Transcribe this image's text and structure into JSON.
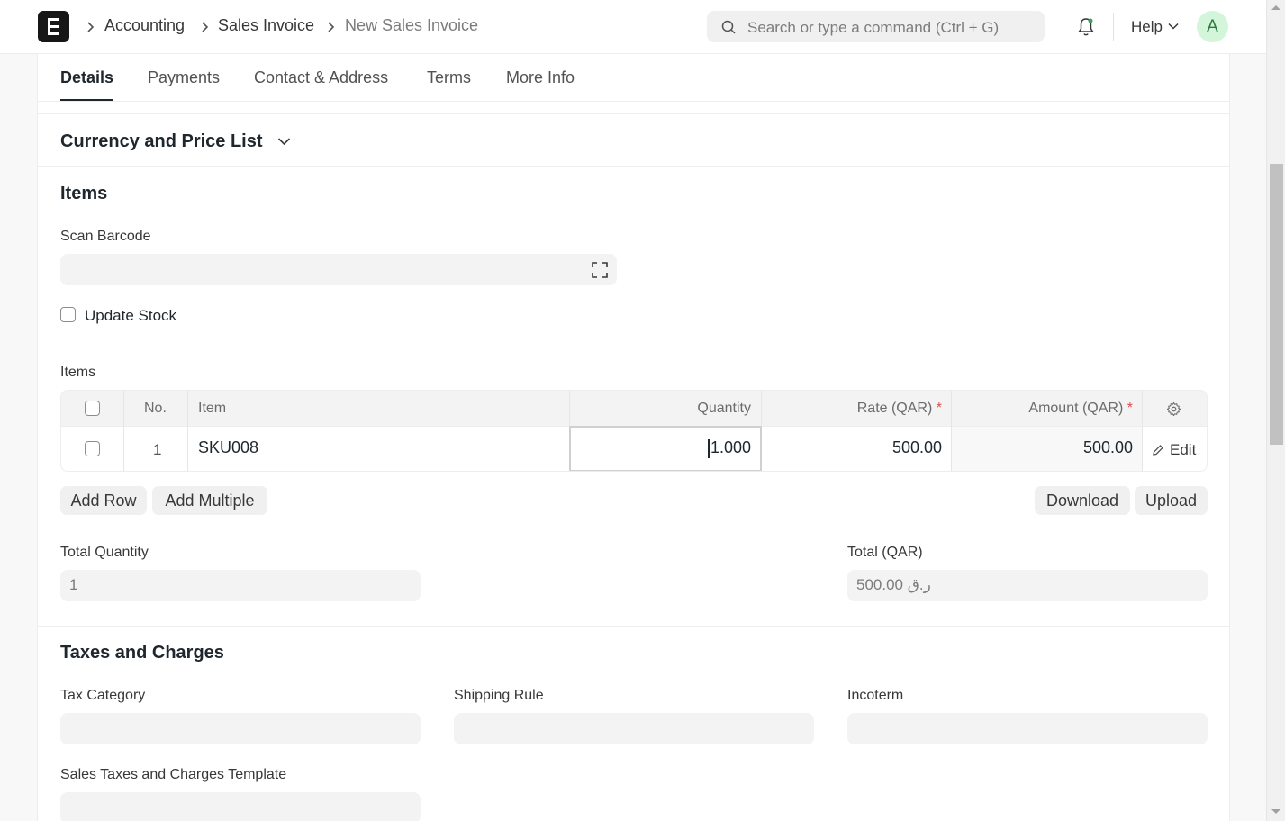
{
  "navbar": {
    "breadcrumbs": [
      "Accounting",
      "Sales Invoice",
      "New Sales Invoice"
    ],
    "search_placeholder": "Search or type a command (Ctrl + G)",
    "help_label": "Help",
    "avatar_initial": "A"
  },
  "tabs": [
    "Details",
    "Payments",
    "Contact & Address",
    "Terms",
    "More Info"
  ],
  "sections": {
    "currency": "Currency and Price List",
    "items": "Items",
    "taxes": "Taxes and Charges"
  },
  "items_section": {
    "scan_barcode_label": "Scan Barcode",
    "update_stock_label": "Update Stock",
    "update_stock_checked": false,
    "grid_label": "Items",
    "columns": {
      "no": "No.",
      "item": "Item",
      "quantity": "Quantity",
      "rate": "Rate (QAR)",
      "amount": "Amount (QAR)",
      "required_marker": "*"
    },
    "rows": [
      {
        "no": "1",
        "item": "SKU008",
        "quantity": "1.000",
        "rate": "500.00",
        "amount": "500.00",
        "edit_label": "Edit"
      }
    ],
    "buttons": {
      "add_row": "Add Row",
      "add_multiple": "Add Multiple",
      "download": "Download",
      "upload": "Upload"
    },
    "total_quantity_label": "Total Quantity",
    "total_quantity_value": "1",
    "total_label": "Total (QAR)",
    "total_value": "ر.ق 500.00"
  },
  "taxes_section": {
    "tax_category_label": "Tax Category",
    "shipping_rule_label": "Shipping Rule",
    "incoterm_label": "Incoterm",
    "template_label": "Sales Taxes and Charges Template"
  },
  "colors": {
    "required": "#e24c4c",
    "avatar_bg": "#d3f5d9",
    "avatar_fg": "#2d7a3d"
  }
}
